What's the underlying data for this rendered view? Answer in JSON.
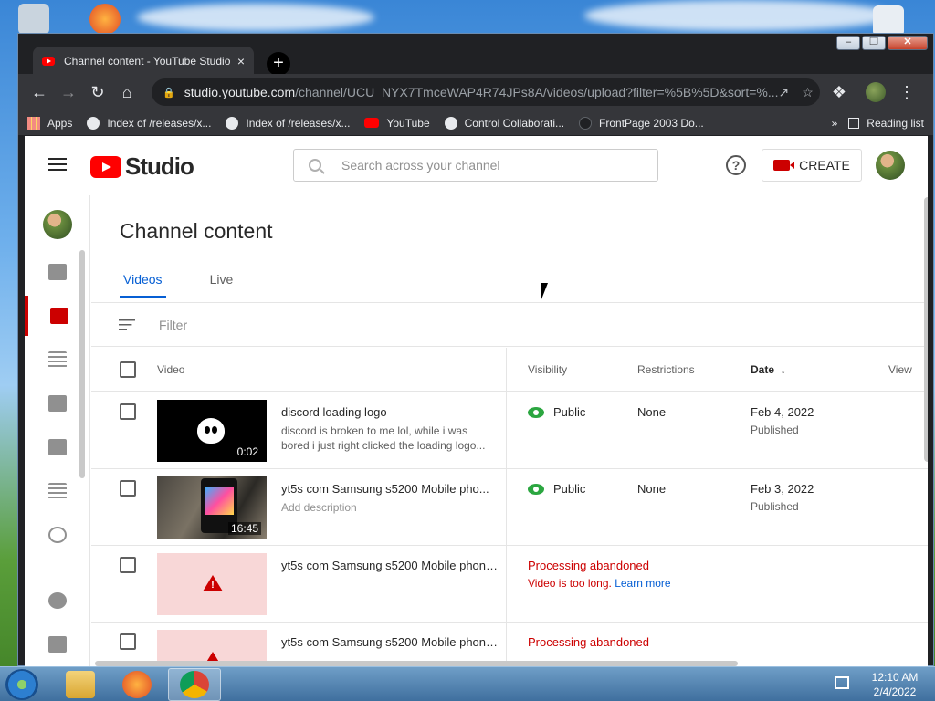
{
  "browser": {
    "tab_title": "Channel content - YouTube Studio",
    "tab_close": "×",
    "new_tab": "+",
    "url_host": "studio.youtube.com",
    "url_path": "/channel/UCU_NYX7TmceWAP4R74JPs8A/videos/upload?filter=%5B%5D&sort=%...",
    "nav": {
      "back": "←",
      "forward": "→",
      "reload": "↻",
      "home": "⌂"
    },
    "window_controls": {
      "minimize": "–",
      "restore": "❐",
      "close": "✕"
    }
  },
  "bookmarks": {
    "items": [
      {
        "label": "Apps",
        "icon": "apps-grid-icon"
      },
      {
        "label": "Index of /releases/x...",
        "icon": "globe-icon"
      },
      {
        "label": "Index of /releases/x...",
        "icon": "globe-icon"
      },
      {
        "label": "YouTube",
        "icon": "youtube-icon"
      },
      {
        "label": "Control Collaborati...",
        "icon": "globe-icon"
      },
      {
        "label": "FrontPage 2003 Do...",
        "icon": "page-icon"
      }
    ],
    "more": "»",
    "reading_list": "Reading list"
  },
  "studio": {
    "logo_text": "Studio",
    "search_placeholder": "Search across your channel",
    "help": "?",
    "create_label": "CREATE",
    "page_title": "Channel content",
    "tabs": [
      {
        "label": "Videos",
        "active": true
      },
      {
        "label": "Live",
        "active": false
      }
    ],
    "filter_placeholder": "Filter",
    "columns": {
      "video": "Video",
      "visibility": "Visibility",
      "restrictions": "Restrictions",
      "date": "Date",
      "date_sort": "↓",
      "views": "View"
    },
    "rows": [
      {
        "title": "discord loading logo",
        "description": "discord is broken to me lol, while i was bored i just right clicked the loading logo...",
        "duration": "0:02",
        "visibility": "Public",
        "restrictions": "None",
        "date": "Feb 4, 2022",
        "date_status": "Published"
      },
      {
        "title": "yt5s com Samsung s5200 Mobile pho...",
        "description": "Add description",
        "duration": "16:45",
        "visibility": "Public",
        "restrictions": "None",
        "date": "Feb 3, 2022",
        "date_status": "Published"
      },
      {
        "title": "yt5s com Samsung s5200 Mobile phone ...",
        "error_title": "Processing abandoned",
        "error_detail": "Video is too long.",
        "learn_more": "Learn more"
      },
      {
        "title": "yt5s com Samsung s5200 Mobile phone ...",
        "error_title": "Processing abandoned"
      }
    ]
  },
  "taskbar": {
    "time": "12:10 AM",
    "date": "2/4/2022"
  },
  "colors": {
    "accent_blue": "#065fd4",
    "youtube_red": "#ff0000",
    "public_green": "#2ba640",
    "error_red": "#cc0000"
  }
}
